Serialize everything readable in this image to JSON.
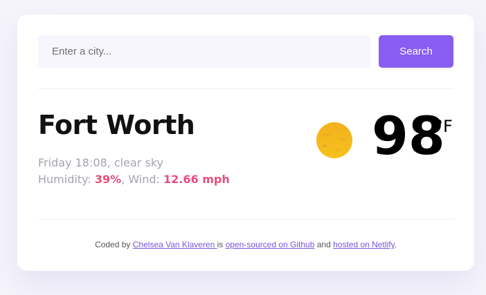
{
  "search": {
    "placeholder": "Enter a city...",
    "button_label": "Search"
  },
  "weather": {
    "city": "Fort Worth",
    "datetime_desc": "Friday 18:08, clear sky",
    "humidity_label": "Humidity: ",
    "humidity_value": "39%",
    "separator": ", ",
    "wind_label": "Wind: ",
    "wind_value": "12.66 mph",
    "temperature": "98",
    "unit": "°F",
    "icon": "sun-icon"
  },
  "footer": {
    "prefix": "Coded by ",
    "author_link": "Chelsea Van Klaveren ",
    "mid1": "is ",
    "github_link": "open-sourced on Github",
    "mid2": " and ",
    "netlify_link": "hosted on Netlify",
    "suffix": "."
  },
  "colors": {
    "accent": "#885df1",
    "highlight": "#ea4c7d",
    "background": "#f5f4fc"
  }
}
